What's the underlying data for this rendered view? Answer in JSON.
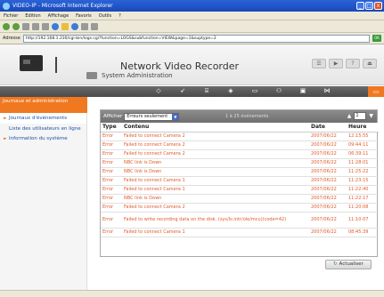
{
  "window": {
    "title": "VIDEO-IP - Microsoft Internet Explorer",
    "min": "_",
    "max": "□",
    "close": "x"
  },
  "menu": [
    "Fichier",
    "Edition",
    "Affichage",
    "Favoris",
    "Outils",
    "?"
  ],
  "address": {
    "label": "Adresse",
    "url": "http://192.168.1.230/cgi-bin/logs.cgi?function=LOGS&subfunction=VIEW&page=1&suptype=2",
    "go": "OK"
  },
  "header": {
    "title": "Network Video Recorder",
    "subtitle": "System Administration",
    "btn_list": "☰",
    "btn_play": "▶",
    "btn_help": "?",
    "btn_exit": "⏏"
  },
  "nav": {
    "icons": [
      "◇",
      "➶",
      "⌸",
      "◈",
      "▭",
      "⚇",
      "▣",
      "⋈"
    ],
    "active": "▭"
  },
  "sidebar": {
    "head": "Journaux et administration",
    "items": [
      {
        "label": "Journaux d'événements"
      },
      {
        "label": "Liste des utilisateurs en ligne"
      },
      {
        "label": "Information du système"
      }
    ]
  },
  "panel": {
    "filter_label": "Afficher",
    "filter_value": "Erreurs seulement",
    "range_text": "1 à 25 événements",
    "page": "1",
    "columns": [
      "Type",
      "Contenu",
      "Date",
      "Heure"
    ],
    "rows": [
      {
        "type": "Error",
        "content": "Failed to connect Camera 2",
        "date": "2007/06/22",
        "time": "12:15:55",
        "tall": false
      },
      {
        "type": "Error",
        "content": "Failed to connect Camera 2",
        "date": "2007/06/22",
        "time": "09:44:11",
        "tall": false
      },
      {
        "type": "Error",
        "content": "Failed to connect Camera 2",
        "date": "2007/06/22",
        "time": "06:39:11",
        "tall": false
      },
      {
        "type": "Error",
        "content": "NBC link is Down",
        "date": "2007/06/22",
        "time": "11:28:01",
        "tall": false
      },
      {
        "type": "Error",
        "content": "NBC link is Down",
        "date": "2007/06/22",
        "time": "11:25:22",
        "tall": false
      },
      {
        "type": "Error",
        "content": "Failed to connect Camera 1",
        "date": "2007/06/22",
        "time": "11:23:15",
        "tall": false
      },
      {
        "type": "Error",
        "content": "Failed to connect Camera 1",
        "date": "2007/06/22",
        "time": "11:22:40",
        "tall": false
      },
      {
        "type": "Error",
        "content": "NBC link is Down",
        "date": "2007/06/22",
        "time": "11:22:17",
        "tall": false
      },
      {
        "type": "Error",
        "content": "Failed to connect Camera 2",
        "date": "2007/06/22",
        "time": "11:20:08",
        "tall": false
      },
      {
        "type": "Error",
        "content": "Failed to write recording data on the disk. (sys/Is:intr/ole/mcu)(code=42)",
        "date": "2007/06/22",
        "time": "11:10:07",
        "tall": true
      },
      {
        "type": "Error",
        "content": "Failed to connect Camera 1",
        "date": "2007/06/22",
        "time": "08:45:39",
        "tall": false
      }
    ]
  },
  "refresh_label": "Actualiser",
  "colors": {
    "accent": "#f07820",
    "error_text": "#e05a2a",
    "link": "#1c4fa3"
  }
}
